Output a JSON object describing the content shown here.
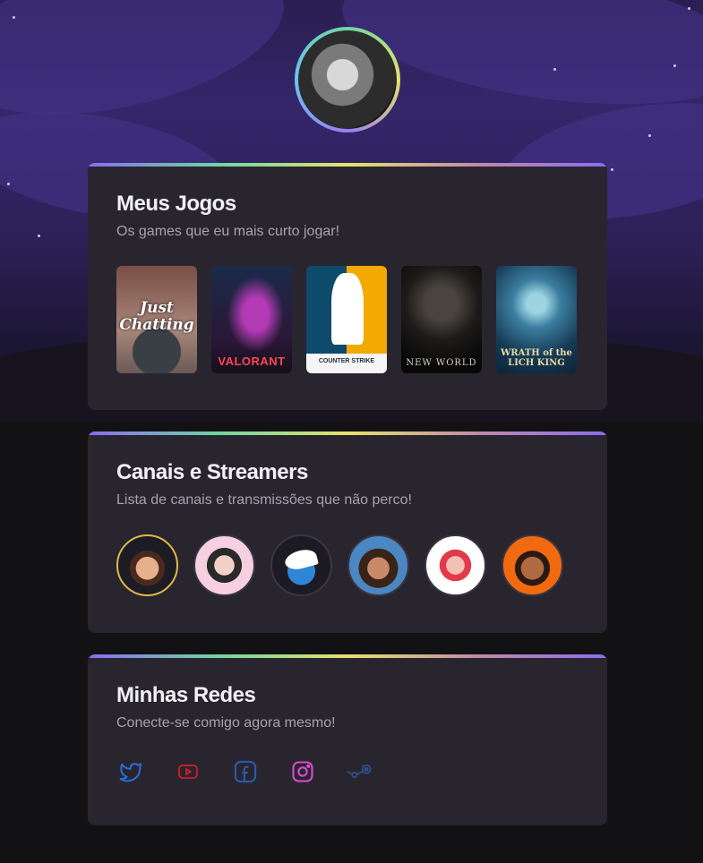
{
  "profile": {
    "avatar_alt": "profile-photo"
  },
  "cards": {
    "games": {
      "title": "Meus Jogos",
      "subtitle": "Os games que eu mais curto jogar!",
      "items": [
        {
          "name": "just-chatting",
          "label": "Just Chatting"
        },
        {
          "name": "valorant",
          "label": "VALORANT"
        },
        {
          "name": "counter-strike",
          "label": "COUNTER STRIKE"
        },
        {
          "name": "new-world",
          "label": "NEW WORLD"
        },
        {
          "name": "wow-lich-king",
          "label": "WRATH of the LICH KING"
        }
      ]
    },
    "channels": {
      "title": "Canais e Streamers",
      "subtitle": "Lista de canais e transmissões que não perco!"
    },
    "socials": {
      "title": "Minhas Redes",
      "subtitle": "Conecte-se comigo agora mesmo!",
      "icons": [
        "twitter-icon",
        "youtube-icon",
        "facebook-icon",
        "instagram-icon",
        "steam-icon"
      ]
    }
  },
  "colors": {
    "background": "#121214",
    "card": "#29252f",
    "title": "#f1f1f4",
    "subtitle": "#a6a3b0",
    "twitter": "#2a6fd8",
    "youtube": "#d01f2a",
    "facebook": "#2b5aa8",
    "instagram": "#d94bd4",
    "steam": "#2f4f8f"
  }
}
